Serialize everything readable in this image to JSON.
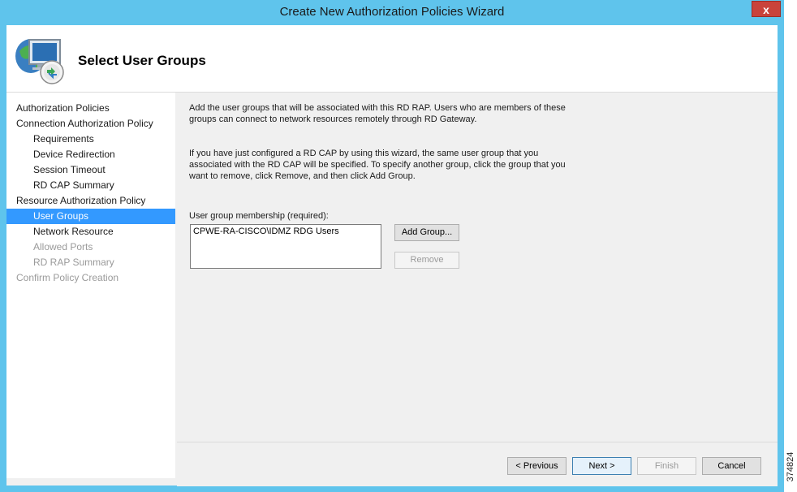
{
  "window": {
    "title": "Create New Authorization Policies Wizard",
    "close_label": "x"
  },
  "header": {
    "title": "Select User Groups"
  },
  "nav": {
    "items": [
      {
        "label": "Authorization Policies"
      },
      {
        "label": "Connection Authorization Policy"
      },
      {
        "label": "Requirements"
      },
      {
        "label": "Device Redirection"
      },
      {
        "label": "Session Timeout"
      },
      {
        "label": "RD CAP Summary"
      },
      {
        "label": "Resource Authorization Policy"
      },
      {
        "label": "User Groups"
      },
      {
        "label": "Network Resource"
      },
      {
        "label": "Allowed Ports"
      },
      {
        "label": "RD RAP Summary"
      },
      {
        "label": "Confirm Policy Creation"
      }
    ]
  },
  "content": {
    "intro_line1": "Add the user groups that will be associated with this RD RAP. Users who are members of these",
    "intro_line2": "groups can connect to network resources remotely through RD Gateway.",
    "info_line1": "If you have just configured a RD CAP by using this wizard, the same user group that you",
    "info_line2": "associated with the RD CAP will be specified. To specify another group, click the group that you",
    "info_line3": "want to remove, click Remove, and then click Add Group.",
    "membership_label": "User group membership (required):",
    "groups": [
      "CPWE-RA-CISCO\\IDMZ RDG Users"
    ],
    "add_group_label": "Add Group...",
    "remove_label": "Remove"
  },
  "footer": {
    "previous_label": "< Previous",
    "next_label": "Next >",
    "finish_label": "Finish",
    "cancel_label": "Cancel"
  },
  "watermark": {
    "text": "374824"
  },
  "colors": {
    "titlebar": "#5fc4ec",
    "selection": "#3399ff",
    "close": "#c9433b"
  }
}
